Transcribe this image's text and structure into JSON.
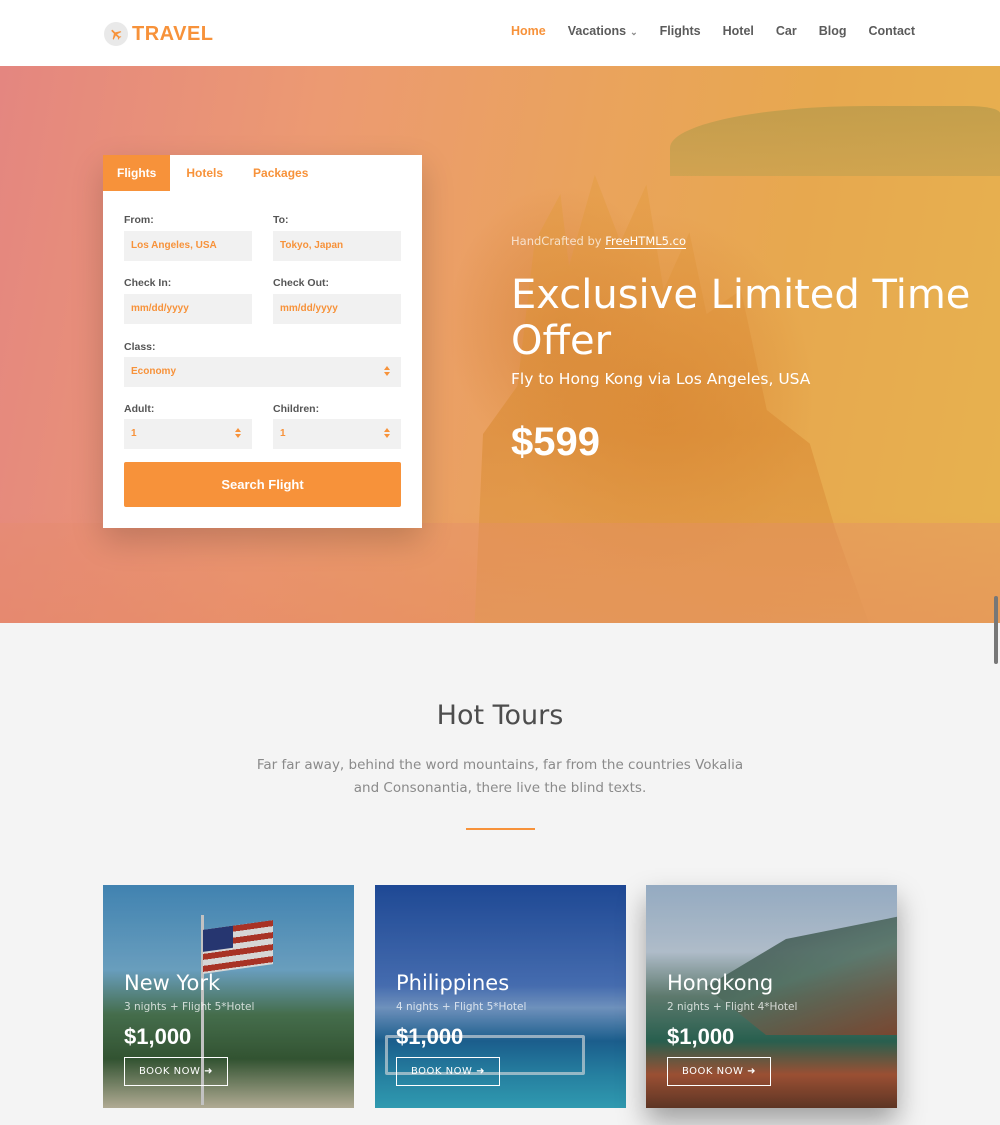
{
  "header": {
    "logo_text": "TRAVEL",
    "nav": [
      {
        "label": "Home",
        "active": true
      },
      {
        "label": "Vacations",
        "has_dropdown": true
      },
      {
        "label": "Flights"
      },
      {
        "label": "Hotel"
      },
      {
        "label": "Car"
      },
      {
        "label": "Blog"
      },
      {
        "label": "Contact"
      }
    ]
  },
  "booking": {
    "tabs": [
      {
        "label": "Flights",
        "active": true
      },
      {
        "label": "Hotels"
      },
      {
        "label": "Packages"
      }
    ],
    "from_label": "From:",
    "from_value": "Los Angeles, USA",
    "to_label": "To:",
    "to_value": "Tokyo, Japan",
    "checkin_label": "Check In:",
    "checkin_placeholder": "mm/dd/yyyy",
    "checkout_label": "Check Out:",
    "checkout_placeholder": "mm/dd/yyyy",
    "class_label": "Class:",
    "class_value": "Economy",
    "adult_label": "Adult:",
    "adult_value": "1",
    "children_label": "Children:",
    "children_value": "1",
    "search_button": "Search Flight"
  },
  "hero": {
    "credit_prefix": "HandCrafted by",
    "credit_link": "FreeHTML5.co",
    "title": "Exclusive Limited Time Offer",
    "subtitle": "Fly to Hong Kong via Los Angeles, USA",
    "price": "$599"
  },
  "tours": {
    "title": "Hot Tours",
    "description": "Far far away, behind the word mountains, far from the countries Vokalia and Consonantia, there live the blind texts.",
    "cards": [
      {
        "name": "New York",
        "meta": "3 nights + Flight 5*Hotel",
        "price": "$1,000",
        "button": "BOOK NOW"
      },
      {
        "name": "Philippines",
        "meta": "4 nights + Flight 5*Hotel",
        "price": "$1,000",
        "button": "BOOK NOW"
      },
      {
        "name": "Hongkong",
        "meta": "2 nights + Flight 4*Hotel",
        "price": "$1,000",
        "button": "BOOK NOW"
      }
    ]
  },
  "colors": {
    "accent": "#f7923a",
    "header_bg": "#ffffff",
    "page_bg": "#f4f4f4"
  },
  "icons": [
    "plane-icon",
    "chevron-down-icon",
    "select-arrows-icon",
    "arrow-right-icon"
  ]
}
